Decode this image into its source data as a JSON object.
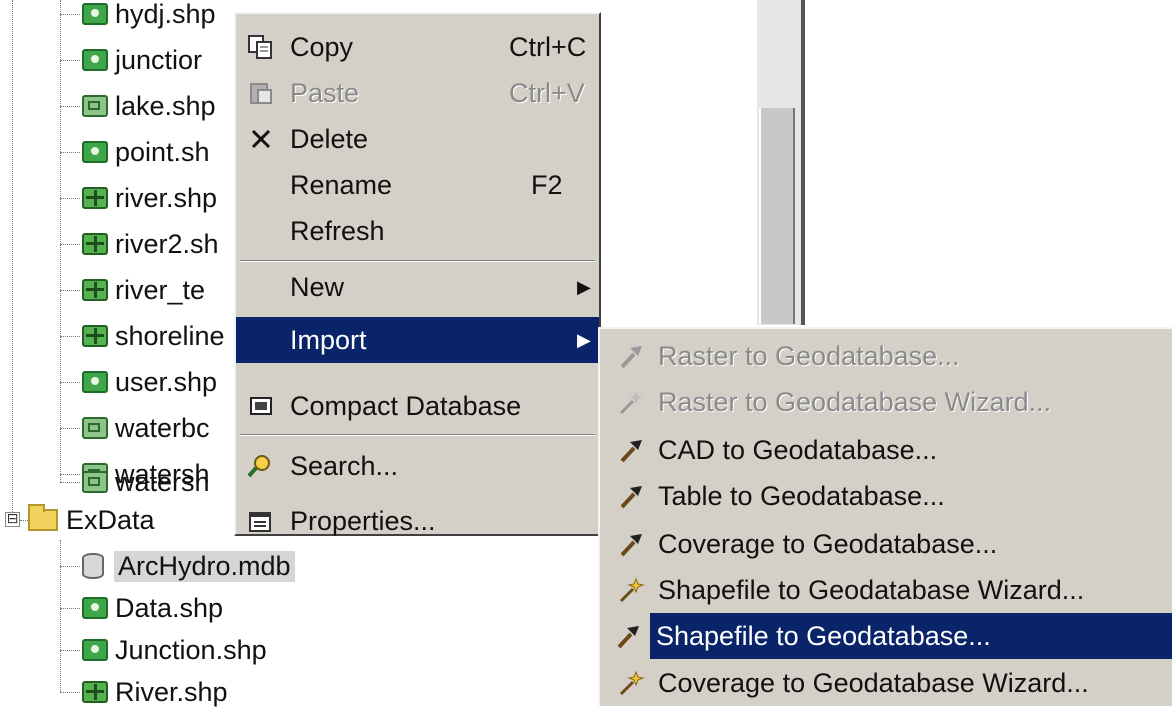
{
  "tree": {
    "items": [
      {
        "label": "hydj.shp",
        "icon": "point"
      },
      {
        "label": "junctior",
        "icon": "point"
      },
      {
        "label": "lake.shp",
        "icon": "polygon"
      },
      {
        "label": "point.sh",
        "icon": "point"
      },
      {
        "label": "river.shp",
        "icon": "line"
      },
      {
        "label": "river2.sh",
        "icon": "line"
      },
      {
        "label": "river_te",
        "icon": "line"
      },
      {
        "label": "shoreline",
        "icon": "line"
      },
      {
        "label": "user.shp",
        "icon": "point"
      },
      {
        "label": "waterbc",
        "icon": "polygon"
      },
      {
        "label": "watersh",
        "icon": "polygon"
      },
      {
        "label": "watersh",
        "icon": "polygon"
      }
    ],
    "folder": {
      "label": "ExData",
      "expander": "⊟"
    },
    "children": [
      {
        "label": "ArcHydro.mdb",
        "icon": "database"
      },
      {
        "label": "Data.shp",
        "icon": "point"
      },
      {
        "label": "Junction.shp",
        "icon": "point"
      },
      {
        "label": "River.shp",
        "icon": "line"
      }
    ]
  },
  "context_menu": {
    "items": [
      {
        "label": "Copy",
        "shortcut": "Ctrl+C",
        "enabled": true
      },
      {
        "label": "Paste",
        "shortcut": "Ctrl+V",
        "enabled": false
      },
      {
        "label": "Delete",
        "shortcut": "",
        "enabled": true
      },
      {
        "label": "Rename",
        "shortcut": "F2",
        "enabled": true
      },
      {
        "label": "Refresh",
        "shortcut": "",
        "enabled": true
      },
      {
        "label": "New",
        "shortcut": "",
        "enabled": true,
        "submenu": true
      },
      {
        "label": "Import",
        "shortcut": "",
        "enabled": true,
        "submenu": true,
        "highlighted": true
      },
      {
        "label": "Compact Database",
        "shortcut": "",
        "enabled": true
      },
      {
        "label": "Search...",
        "shortcut": "",
        "enabled": true
      },
      {
        "label": "Properties...",
        "shortcut": "",
        "enabled": true
      }
    ]
  },
  "import_submenu": {
    "items": [
      {
        "label": "Raster to Geodatabase...",
        "icon": "tool-icon",
        "enabled": false
      },
      {
        "label": "Raster to Geodatabase Wizard...",
        "icon": "wizard-icon",
        "enabled": false
      },
      {
        "label": "CAD to Geodatabase...",
        "icon": "tool-icon",
        "enabled": true
      },
      {
        "label": "Table to Geodatabase...",
        "icon": "tool-icon",
        "enabled": true
      },
      {
        "label": "Coverage to Geodatabase...",
        "icon": "tool-icon",
        "enabled": true
      },
      {
        "label": "Shapefile to Geodatabase Wizard...",
        "icon": "wizard-icon",
        "enabled": true
      },
      {
        "label": "Shapefile to Geodatabase...",
        "icon": "tool-icon",
        "enabled": true,
        "highlighted": true
      },
      {
        "label": "Coverage to Geodatabase Wizard...",
        "icon": "wizard-icon",
        "enabled": true
      }
    ]
  },
  "colors": {
    "menu_bg": "#d4d0c8",
    "highlight": "#0a246a",
    "disabled_text": "#8a8a8a"
  }
}
